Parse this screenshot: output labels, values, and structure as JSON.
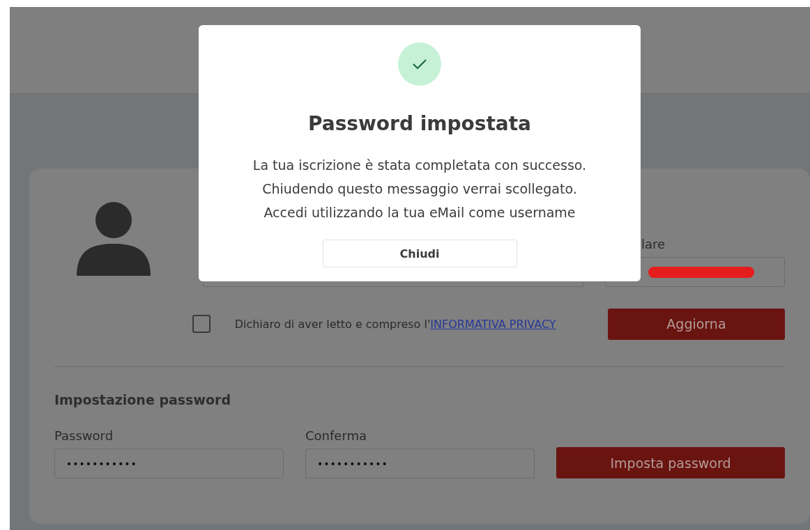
{
  "dialog": {
    "title": "Password impostata",
    "lines": [
      "La tua iscrizione è stata completata con successo.",
      "Chiudendo questo messaggio verrai scollegato.",
      "Accedi utilizzando la tua eMail come username"
    ],
    "close_button": "Chiudi"
  },
  "profile": {
    "phone_label": "lare",
    "privacy": {
      "checked": false,
      "text": "Dichiaro di aver letto e compreso l'",
      "link": "INFORMATIVA PRIVACY"
    },
    "update_button": "Aggiorna"
  },
  "password_section": {
    "title": "Impostazione password",
    "fields": [
      {
        "label": "Password",
        "value": "•••••••••••"
      },
      {
        "label": "Conferma",
        "value": "•••••••••••"
      }
    ],
    "button": "Imposta password"
  }
}
